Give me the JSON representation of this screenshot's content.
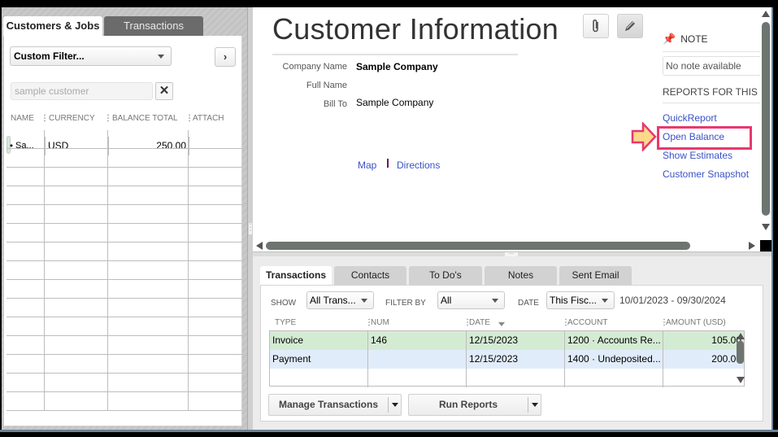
{
  "left_panel": {
    "tabs": [
      {
        "label": "Customers & Jobs",
        "active": true
      },
      {
        "label": "Transactions",
        "active": false
      }
    ],
    "filter": {
      "selected": "Custom Filter..."
    },
    "next_button": "›",
    "search": {
      "value": "",
      "placeholder": "sample customer"
    },
    "clear_button": "✕",
    "columns": [
      "NAME",
      "CURRENCY",
      "BALANCE TOTAL",
      "ATTACH"
    ],
    "rows": [
      {
        "name": "⬩ Sa...",
        "currency": "USD",
        "balance_total": "250.00",
        "attach": ""
      }
    ]
  },
  "customer_info": {
    "title": "Customer Information",
    "attach_icon": "paperclip-icon",
    "edit_icon": "pencil-icon",
    "fields": [
      {
        "label": "Company Name",
        "value": "Sample Company"
      },
      {
        "label": "Full Name",
        "value": ""
      },
      {
        "label": "Bill To",
        "value": "Sample Company"
      }
    ],
    "map_link": "Map",
    "directions_link": "Directions",
    "note": {
      "heading": "NOTE",
      "icon": "pin-icon",
      "text": "No note available"
    },
    "reports": {
      "heading": "REPORTS FOR THIS",
      "links": [
        "QuickReport",
        "Open Balance",
        "Show Estimates",
        "Customer Snapshot"
      ],
      "highlighted": "Open Balance"
    },
    "highlight_color": "#e8386e",
    "arrow_color": "#fbd98a"
  },
  "bottom_panel": {
    "tabs": [
      {
        "label": "Transactions",
        "active": true
      },
      {
        "label": "Contacts",
        "active": false
      },
      {
        "label": "To Do's",
        "active": false
      },
      {
        "label": "Notes",
        "active": false
      },
      {
        "label": "Sent Email",
        "active": false
      }
    ],
    "filters": {
      "show_label": "SHOW",
      "show_value": "All Trans...",
      "filter_by_label": "FILTER BY",
      "filter_by_value": "All",
      "date_label": "DATE",
      "date_value": "This Fisc...",
      "date_range": "10/01/2023 - 09/30/2024"
    },
    "columns": [
      "TYPE",
      "NUM",
      "DATE",
      "ACCOUNT",
      "AMOUNT (USD)"
    ],
    "rows": [
      {
        "type": "Invoice",
        "num": "146",
        "date": "12/15/2023",
        "account": "1200 · Accounts Re...",
        "amount": "105.00"
      },
      {
        "type": "Payment",
        "num": "",
        "date": "12/15/2023",
        "account": "1400 · Undeposited...",
        "amount": "200.00"
      }
    ],
    "buttons": {
      "manage": "Manage Transactions",
      "reports": "Run Reports"
    }
  }
}
